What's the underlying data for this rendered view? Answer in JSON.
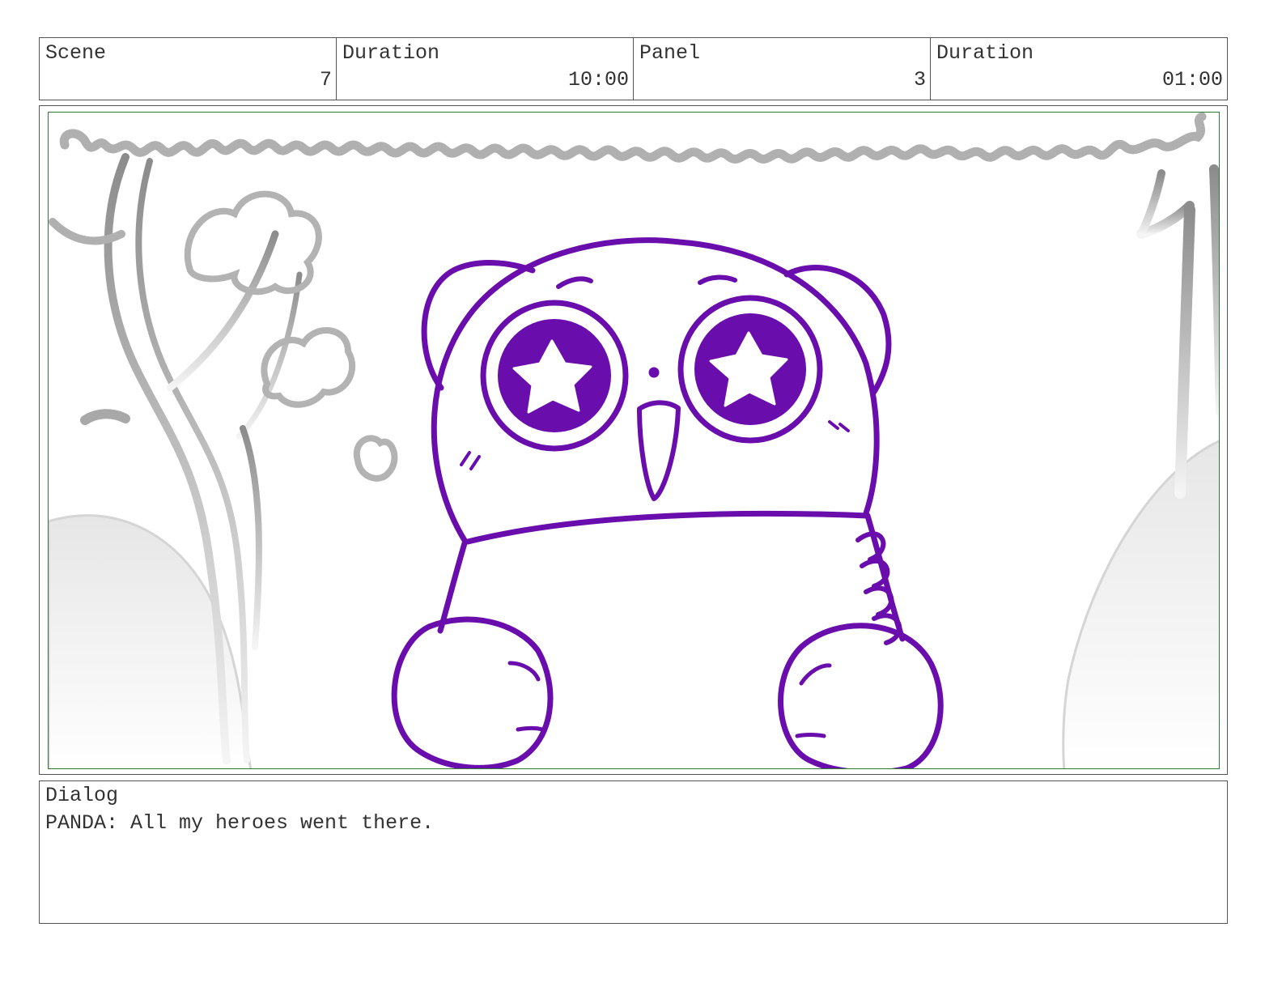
{
  "header": {
    "scene": {
      "label": "Scene",
      "value": "7"
    },
    "scene_duration": {
      "label": "Duration",
      "value": "10:00"
    },
    "panel": {
      "label": "Panel",
      "value": "3"
    },
    "panel_duration": {
      "label": "Duration",
      "value": "01:00"
    }
  },
  "artwork": {
    "character_color": "#6a0dad",
    "background_color": "#9e9e9e",
    "frame_color": "#2e7d32"
  },
  "dialog": {
    "label": "Dialog",
    "text": "PANDA: All my heroes went there."
  }
}
